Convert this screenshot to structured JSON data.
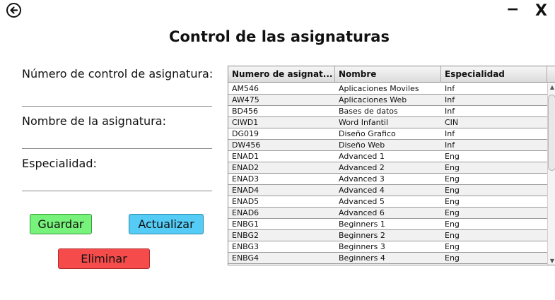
{
  "window": {
    "minimize_label": "−",
    "close_label": "X"
  },
  "title": "Control de las asignaturas",
  "form": {
    "control_label": "Número de control de asignatura:",
    "nombre_label": "Nombre de la asignatura:",
    "especialidad_label": "Especialidad:",
    "control_value": "",
    "nombre_value": "",
    "especialidad_value": ""
  },
  "buttons": {
    "guardar": "Guardar",
    "actualizar": "Actualizar",
    "eliminar": "Eliminar"
  },
  "table": {
    "columns": [
      "Numero de asignat...",
      "Nombre",
      "Especialidad"
    ],
    "rows": [
      [
        "AM546",
        "Aplicaciones Moviles",
        "Inf"
      ],
      [
        "AW475",
        "Aplicaciones Web",
        "Inf"
      ],
      [
        "BD456",
        "Bases de datos",
        "Inf"
      ],
      [
        "CIWD1",
        "Word Infantil",
        "CIN"
      ],
      [
        "DG019",
        "Diseño Grafico",
        "Inf"
      ],
      [
        "DW456",
        "Diseño Web",
        "Inf"
      ],
      [
        "ENAD1",
        "Advanced 1",
        "Eng"
      ],
      [
        "ENAD2",
        "Advanced 2",
        "Eng"
      ],
      [
        "ENAD3",
        "Advanced 3",
        "Eng"
      ],
      [
        "ENAD4",
        "Advanced 4",
        "Eng"
      ],
      [
        "ENAD5",
        "Advanced 5",
        "Eng"
      ],
      [
        "ENAD6",
        "Advanced 6",
        "Eng"
      ],
      [
        "ENBG1",
        "Beginners 1",
        "Eng"
      ],
      [
        "ENBG2",
        "Beginners 2",
        "Eng"
      ],
      [
        "ENBG3",
        "Beginners 3",
        "Eng"
      ],
      [
        "ENBG4",
        "Beginners 4",
        "Eng"
      ]
    ],
    "scroll_up_icon": "▲",
    "scroll_down_icon": "▼"
  },
  "colors": {
    "guardar": "#77f27a",
    "actualizar": "#55ccf5",
    "eliminar": "#f54b4b"
  }
}
